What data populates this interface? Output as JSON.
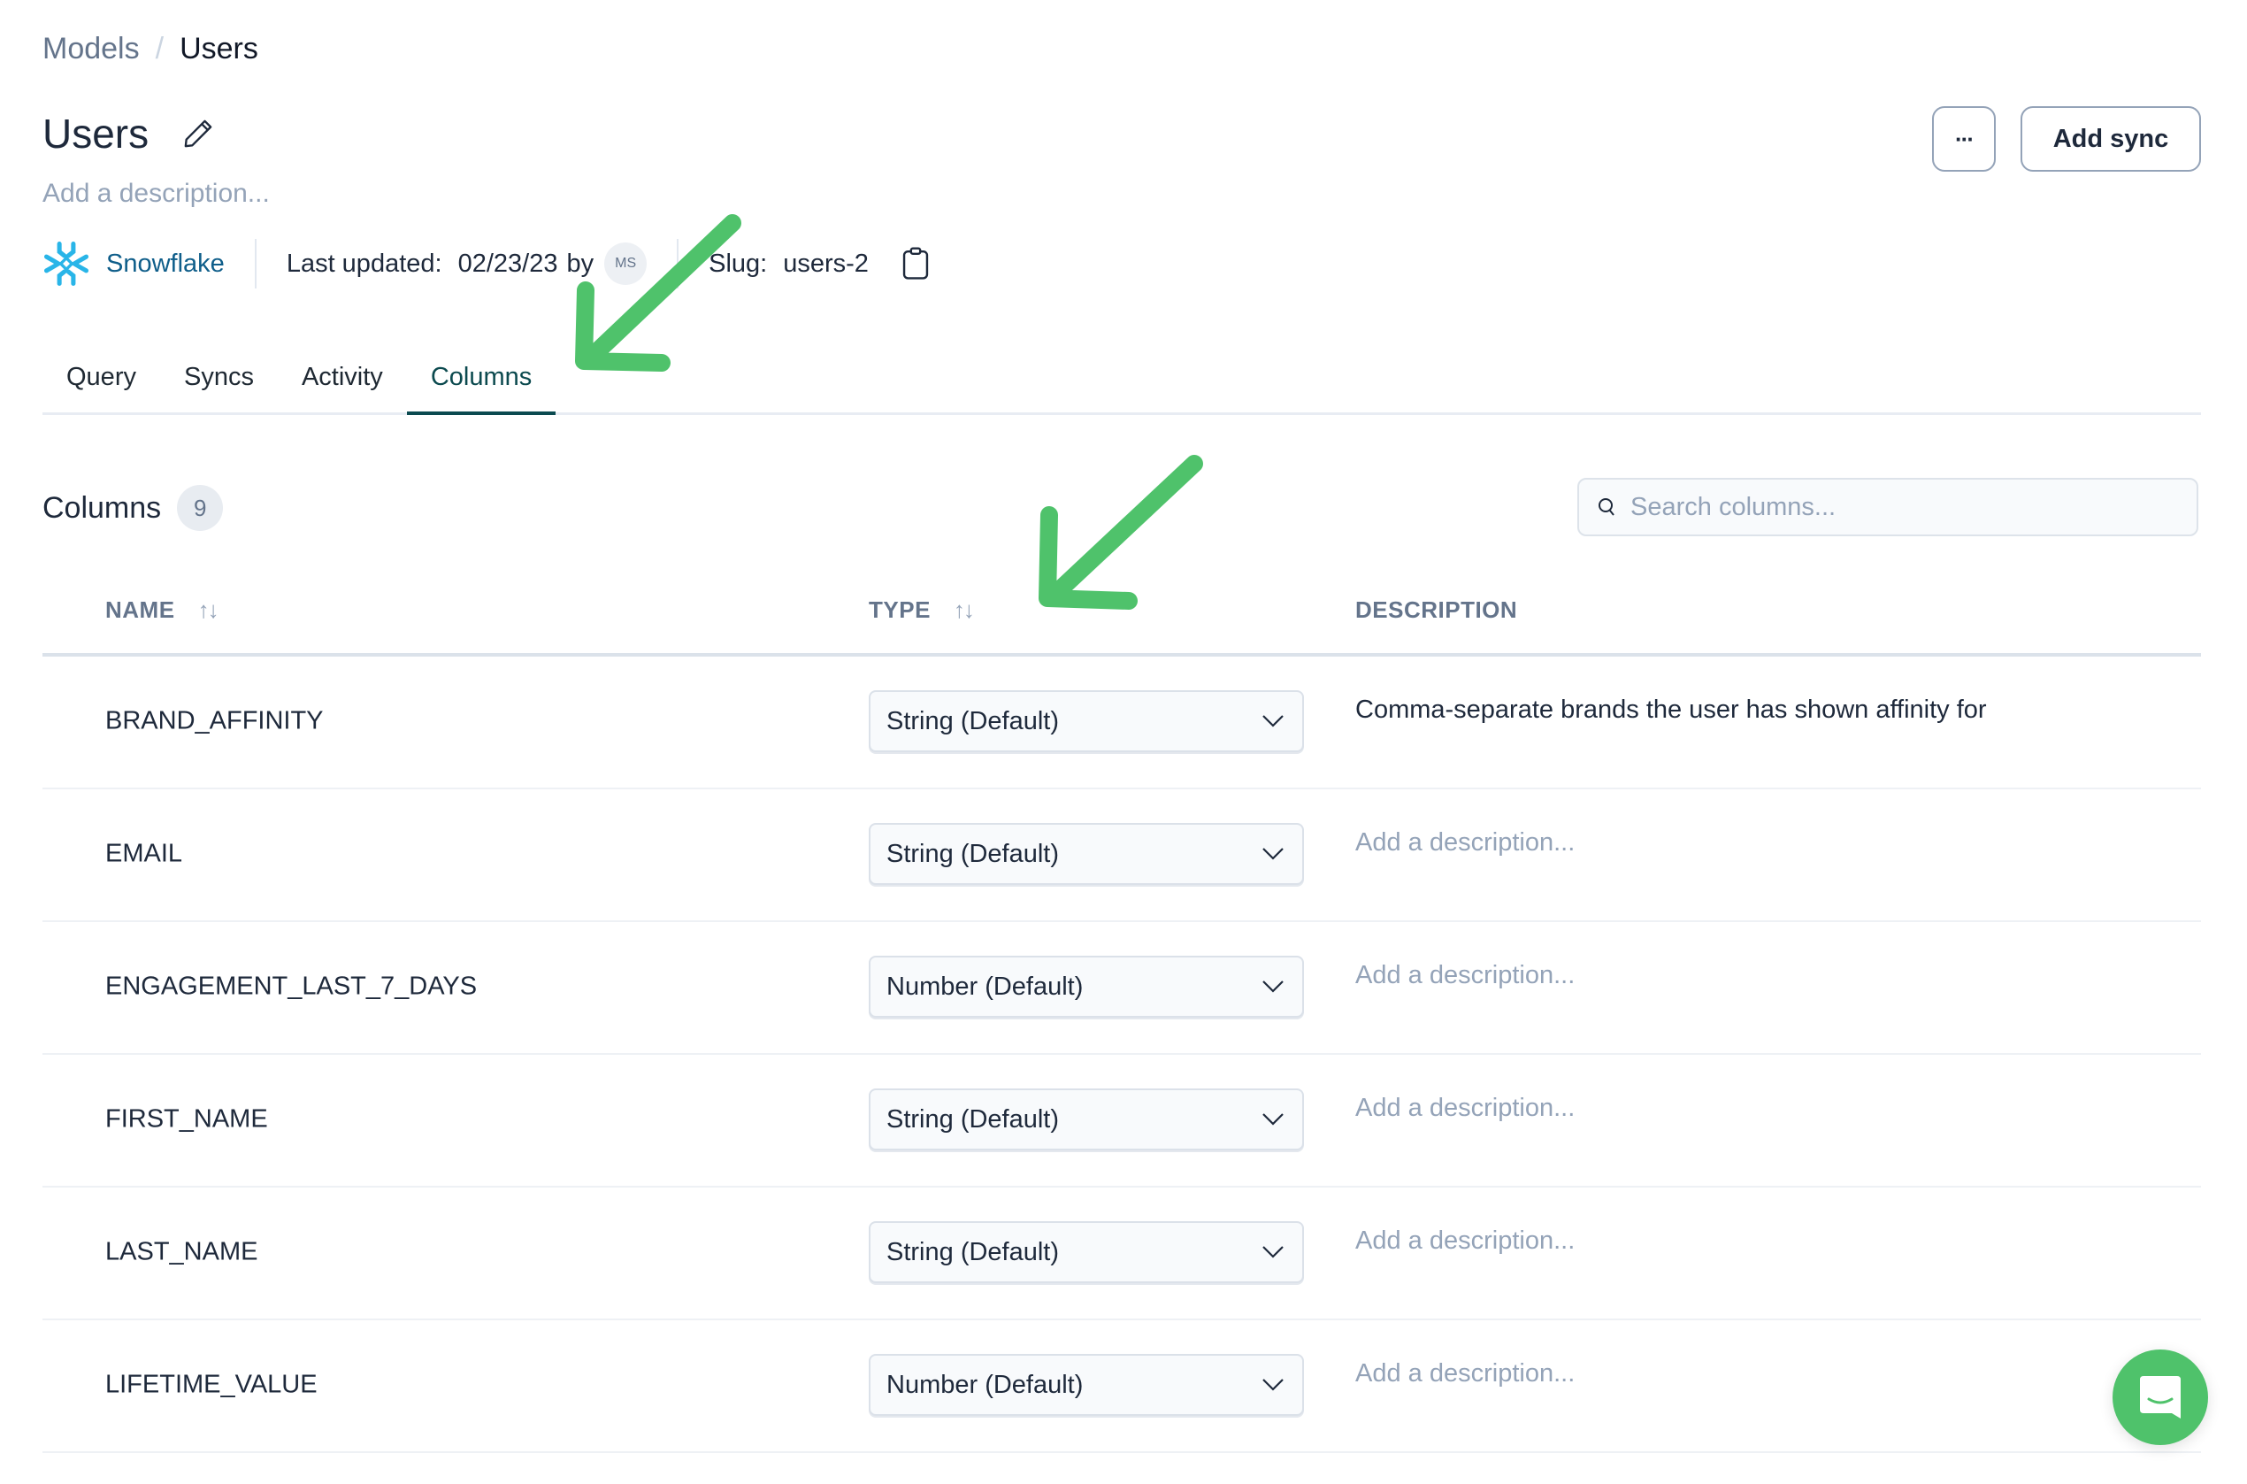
{
  "breadcrumb": {
    "parent": "Models",
    "separator": "/",
    "current": "Users"
  },
  "header": {
    "title": "Users",
    "description_placeholder": "Add a description...",
    "more_button_label": "···",
    "add_sync_label": "Add sync"
  },
  "meta": {
    "source_name": "Snowflake",
    "last_updated_label": "Last updated:",
    "last_updated_date": "02/23/23",
    "by_label": "by",
    "avatar_initials": "MS",
    "slug_label": "Slug:",
    "slug_value": "users-2"
  },
  "tabs": [
    {
      "label": "Query",
      "active": false
    },
    {
      "label": "Syncs",
      "active": false
    },
    {
      "label": "Activity",
      "active": false
    },
    {
      "label": "Columns",
      "active": true
    }
  ],
  "columns_section": {
    "title": "Columns",
    "count": "9",
    "search_placeholder": "Search columns...",
    "search_value": ""
  },
  "table": {
    "headers": {
      "name": "NAME",
      "type": "TYPE",
      "description": "DESCRIPTION"
    },
    "sort_glyph": "↑↓",
    "rows": [
      {
        "name": "BRAND_AFFINITY",
        "type": "String (Default)",
        "description": "Comma-separate brands the user has shown affinity for"
      },
      {
        "name": "EMAIL",
        "type": "String (Default)",
        "description": "Add a description..."
      },
      {
        "name": "ENGAGEMENT_LAST_7_DAYS",
        "type": "Number (Default)",
        "description": "Add a description..."
      },
      {
        "name": "FIRST_NAME",
        "type": "String (Default)",
        "description": "Add a description..."
      },
      {
        "name": "LAST_NAME",
        "type": "String (Default)",
        "description": "Add a description..."
      },
      {
        "name": "LIFETIME_VALUE",
        "type": "Number (Default)",
        "description": "Add a description..."
      }
    ]
  },
  "colors": {
    "accent": "#0b4a50",
    "snowflake_blue": "#29b5e8",
    "annotation_green": "#4fc26b",
    "chat_green": "#4fc26b"
  }
}
